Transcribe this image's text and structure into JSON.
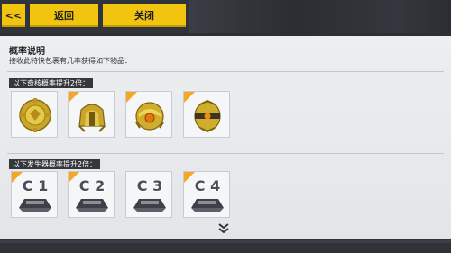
{
  "toolbar": {
    "back_arrow": "<<",
    "back_label": "返回",
    "close_label": "关闭"
  },
  "panel": {
    "title": "概率说明",
    "description": "接收此特快包裹有几率获得如下物品："
  },
  "sections": [
    {
      "label": "以下奇核概率提升2倍：",
      "items": [
        {
          "name": "core-item-1",
          "icon": "round-core-icon",
          "highlight": false
        },
        {
          "name": "core-item-2",
          "icon": "helmet-core-icon",
          "highlight": true
        },
        {
          "name": "core-item-3",
          "icon": "orb-core-icon",
          "highlight": true
        },
        {
          "name": "core-item-4",
          "icon": "capsule-core-icon",
          "highlight": true
        }
      ]
    },
    {
      "label": "以下发生器概率提升2倍：",
      "items": [
        {
          "name": "generator-c1",
          "label": "C 1",
          "highlight": true
        },
        {
          "name": "generator-c2",
          "label": "C 2",
          "highlight": true
        },
        {
          "name": "generator-c3",
          "label": "C 3",
          "highlight": false
        },
        {
          "name": "generator-c4",
          "label": "C 4",
          "highlight": true
        }
      ]
    }
  ],
  "colors": {
    "accent": "#f1c40f",
    "corner": "#f5a623",
    "gold": "#d8b632",
    "dark": "#2c2f33"
  }
}
